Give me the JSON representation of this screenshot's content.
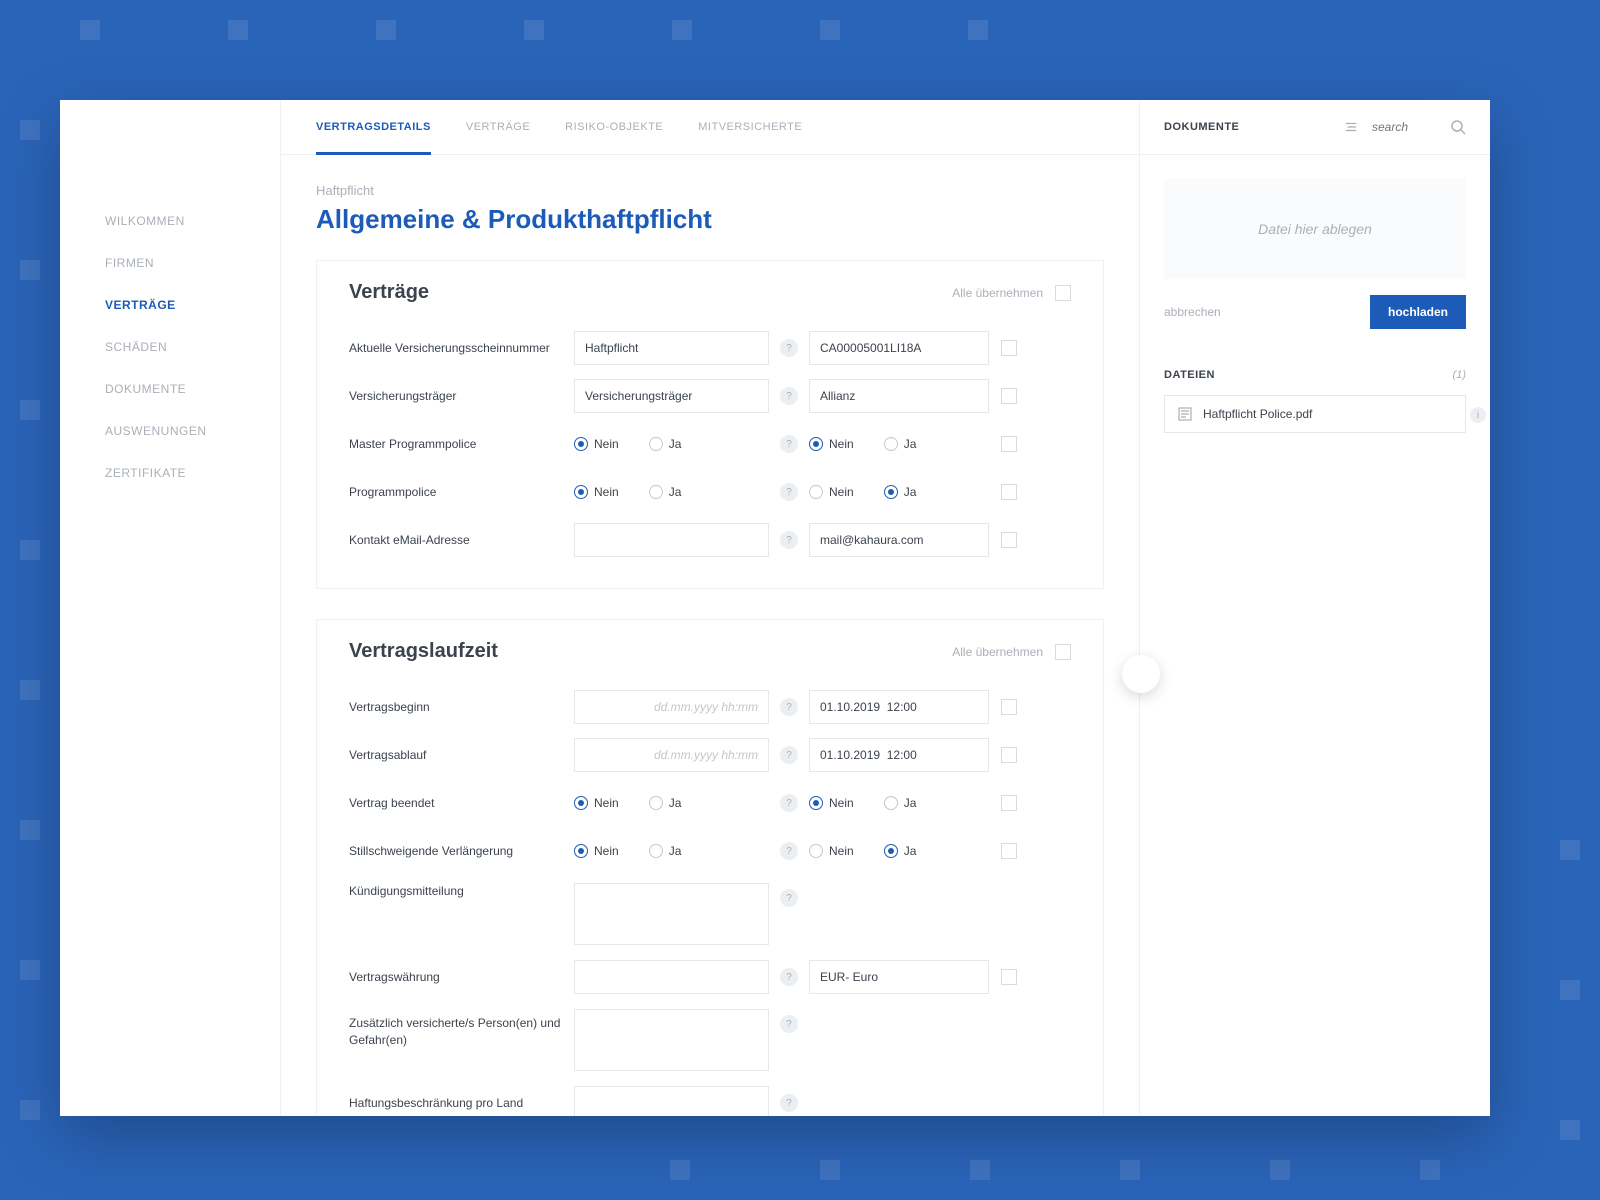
{
  "sidebar": {
    "items": [
      {
        "label": "WILKOMMEN"
      },
      {
        "label": "FIRMEN"
      },
      {
        "label": "VERTRÄGE"
      },
      {
        "label": "SCHÄDEN"
      },
      {
        "label": "DOKUMENTE"
      },
      {
        "label": "AUSWENUNGEN"
      },
      {
        "label": "ZERTIFIKATE"
      }
    ],
    "activeIndex": 2
  },
  "tabs": {
    "items": [
      {
        "label": "VERTRAGSDETAILS"
      },
      {
        "label": "VERTRÄGE"
      },
      {
        "label": "RISIKO-OBJEKTE"
      },
      {
        "label": "MITVERSICHERTE"
      }
    ],
    "activeIndex": 0
  },
  "header": {
    "breadcrumb": "Haftpflicht",
    "title": "Allgemeine & Produkthaftpflicht"
  },
  "labels": {
    "adopt_all": "Alle übernehmen",
    "nein": "Nein",
    "ja": "Ja"
  },
  "panel1": {
    "title": "Verträge",
    "rows": {
      "policy_number": {
        "label": "Aktuelle Versicherungsscheinnummer",
        "left_val": "Haftpflicht",
        "right_val": "CA00005001LI18A"
      },
      "carrier": {
        "label": "Versicherungsträger",
        "left_val": "Versicherungsträger",
        "right_val": "Allianz"
      },
      "master_policy": {
        "label": "Master Programmpolice",
        "left_sel": "Nein",
        "right_sel": "Nein"
      },
      "program_policy": {
        "label": "Programmpolice",
        "left_sel": "Nein",
        "right_sel": "Ja"
      },
      "contact_email": {
        "label": "Kontakt eMail-Adresse",
        "left_val": "",
        "right_val": "mail@kahaura.com"
      }
    }
  },
  "panel2": {
    "title": "Vertragslaufzeit",
    "date_placeholder": "dd.mm.yyyy hh:mm",
    "rows": {
      "start": {
        "label": "Vertragsbeginn",
        "left_val": "",
        "right_val": "01.10.2019  12:00"
      },
      "end": {
        "label": "Vertragsablauf",
        "left_val": "",
        "right_val": "01.10.2019  12:00"
      },
      "terminated": {
        "label": "Vertrag beendet",
        "left_sel": "Nein",
        "right_sel": "Nein"
      },
      "tacit_renewal": {
        "label": "Stillschweigende Verlängerung",
        "left_sel": "Nein",
        "right_sel": "Ja"
      },
      "termination_notice": {
        "label": "Kündigungsmitteilung"
      },
      "currency": {
        "label": "Vertragswährung",
        "right_val": "EUR- Euro"
      },
      "additional_insured": {
        "label": "Zusätzlich versicherte/s Person(en) und Gefahr(en)"
      },
      "liability_limit": {
        "label": "Haftungsbeschränkung pro Land"
      }
    }
  },
  "right": {
    "header_label": "DOKUMENTE",
    "search_placeholder": "search",
    "dropzone": "Datei hier ablegen",
    "cancel": "abbrechen",
    "upload": "hochladen",
    "files_label": "DATEIEN",
    "files_count": "(1)",
    "file_name": "Haftpflicht Police.pdf"
  }
}
